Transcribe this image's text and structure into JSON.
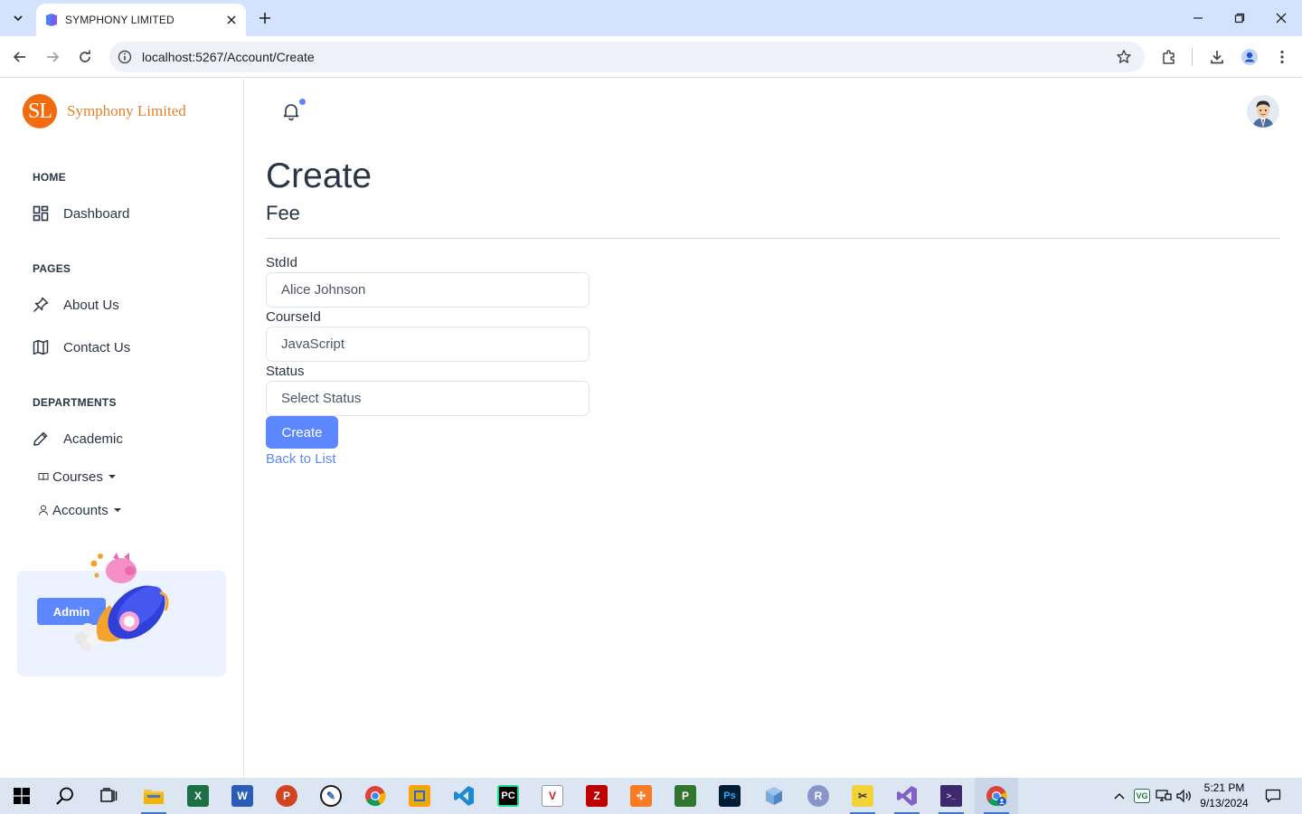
{
  "browser": {
    "tab_title": "SYMPHONY LIMITED",
    "url": "localhost:5267/Account/Create"
  },
  "brand": {
    "logo_text": "SL",
    "name": "Symphony Limited"
  },
  "sidebar": {
    "sections": [
      {
        "caption": "HOME"
      },
      {
        "caption": "PAGES"
      },
      {
        "caption": "DEPARTMENTS"
      }
    ],
    "items": [
      {
        "label": "Dashboard",
        "icon": "dashboard-icon"
      },
      {
        "label": "About Us",
        "icon": "pin-icon"
      },
      {
        "label": "Contact Us",
        "icon": "map-icon"
      },
      {
        "label": "Academic",
        "icon": "pencil-icon"
      }
    ],
    "dropdowns": [
      {
        "label": "Courses",
        "icon": "book-icon"
      },
      {
        "label": "Accounts",
        "icon": "user-icon"
      }
    ],
    "promo_button": "Admin"
  },
  "page": {
    "title": "Create",
    "subtitle": "Fee",
    "fields": [
      {
        "label": "StdId",
        "value": "Alice Johnson"
      },
      {
        "label": "CourseId",
        "value": "JavaScript"
      },
      {
        "label": "Status",
        "value": "Select Status"
      }
    ],
    "submit_label": "Create",
    "back_link": "Back to List"
  },
  "taskbar": {
    "time": "5:21 PM",
    "date": "9/13/2024"
  },
  "colors": {
    "accent": "#5d87ff",
    "brand": "#f26b0f",
    "text": "#2a3547"
  }
}
